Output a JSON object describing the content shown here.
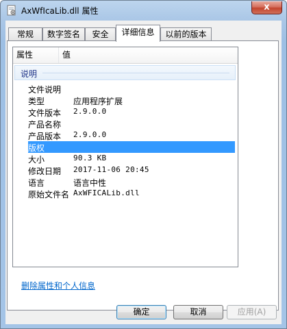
{
  "window": {
    "title": "AxWfIcaLib.dll 属性",
    "close_glyph": "x"
  },
  "tabs": [
    {
      "label": "常规"
    },
    {
      "label": "数字签名"
    },
    {
      "label": "安全"
    },
    {
      "label": "详细信息"
    },
    {
      "label": "以前的版本"
    }
  ],
  "details": {
    "columns": {
      "property": "属性",
      "value": "值"
    },
    "group": "说明",
    "rows": [
      {
        "key": "文件说明",
        "value": ""
      },
      {
        "key": "类型",
        "value": "应用程序扩展"
      },
      {
        "key": "文件版本",
        "value": "2.9.0.0"
      },
      {
        "key": "产品名称",
        "value": ""
      },
      {
        "key": "产品版本",
        "value": "2.9.0.0"
      },
      {
        "key": "版权",
        "value": ""
      },
      {
        "key": "大小",
        "value": "90.3 KB"
      },
      {
        "key": "修改日期",
        "value": "2017-11-06 20:45"
      },
      {
        "key": "语言",
        "value": "语言中性"
      },
      {
        "key": "原始文件名",
        "value": "AxWFICALib.dll"
      }
    ]
  },
  "remove_link": "删除属性和个人信息",
  "buttons": {
    "ok": "确定",
    "cancel": "取消",
    "apply": "应用(A)"
  },
  "colors": {
    "selection": "#3399ff",
    "link": "#0066cc",
    "group_header": "#1e3287"
  }
}
